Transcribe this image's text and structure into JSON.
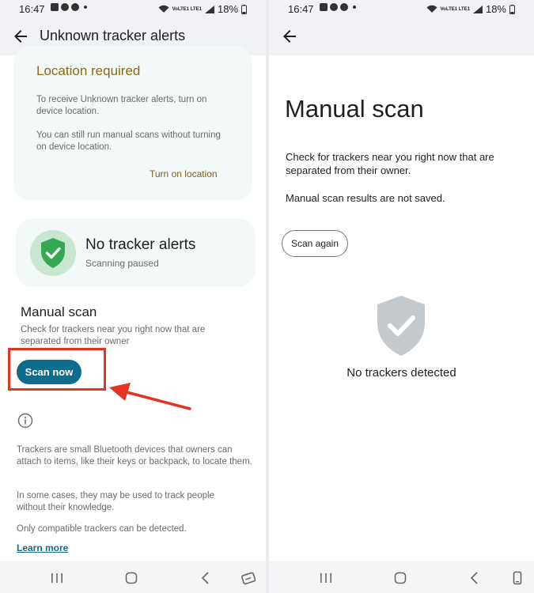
{
  "left": {
    "statusbar": {
      "time": "16:47",
      "battery": "18%",
      "net_label": "VoLTE1 LTE1"
    },
    "appbar": {
      "title": "Unknown tracker alerts"
    },
    "location_card": {
      "title": "Location required",
      "p1": "To receive Unknown tracker alerts, turn on device location.",
      "p2": "You can still run manual scans without turning on device location.",
      "action": "Turn on location"
    },
    "status_card": {
      "title": "No tracker alerts",
      "subtitle": "Scanning paused"
    },
    "manual": {
      "title": "Manual scan",
      "desc": "Check for trackers near you right now that are separated from their owner",
      "button": "Scan now"
    },
    "info": {
      "p1": "Trackers are small Bluetooth devices that owners can attach to items, like their keys or backpack, to locate them.",
      "p2": "In some cases, they may be used to track people without their knowledge.",
      "p3": "Only compatible trackers can be detected.",
      "link": "Learn more"
    }
  },
  "right": {
    "statusbar": {
      "time": "16:47",
      "battery": "18%",
      "net_label": "VoLTE1 LTE1"
    },
    "title": "Manual scan",
    "p1": "Check for trackers near you right now that are separated from their owner.",
    "p2": "Manual scan results are not saved.",
    "button": "Scan again",
    "result": "No trackers detected"
  },
  "colors": {
    "accent": "#0e6d8c",
    "gold": "#8a6a12",
    "highlight": "#e53322",
    "shield_green": "#34a853",
    "shield_grey": "#c4c9cd"
  }
}
